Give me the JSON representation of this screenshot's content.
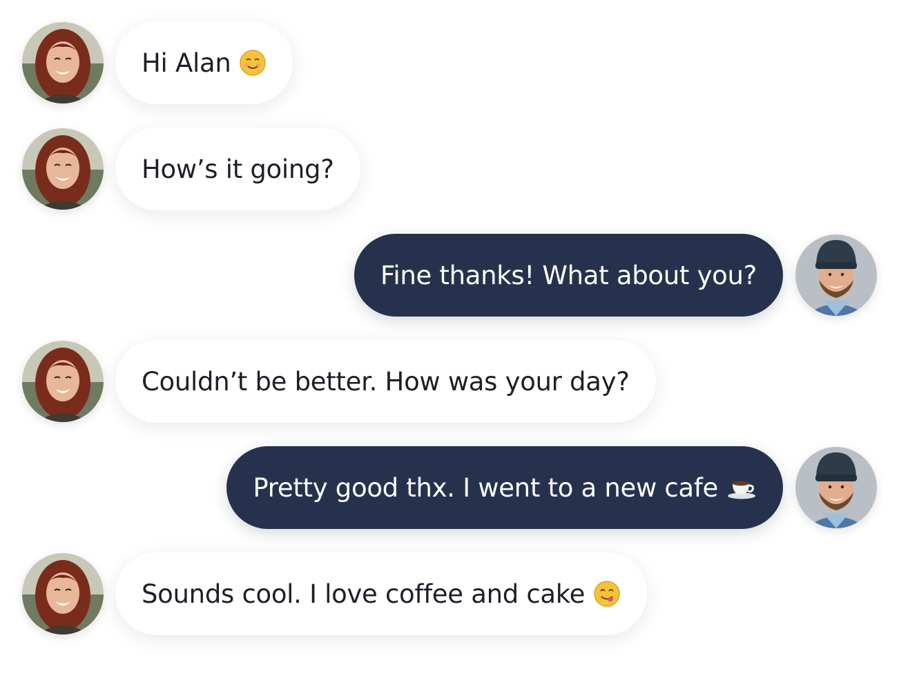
{
  "conversation": {
    "messages": [
      {
        "side": "incoming",
        "text": "Hi Alan",
        "emoji": "smiling-face-icon"
      },
      {
        "side": "incoming",
        "text": "How’s it going?",
        "emoji": ""
      },
      {
        "side": "outgoing",
        "text": "Fine thanks! What about you?",
        "emoji": ""
      },
      {
        "side": "incoming",
        "text": "Couldn’t be better. How was your day?",
        "emoji": ""
      },
      {
        "side": "outgoing",
        "text": "Pretty good thx. I went to a new cafe",
        "emoji": "coffee-icon"
      },
      {
        "side": "incoming",
        "text": "Sounds cool. I love coffee and cake",
        "emoji": "yum-face-icon"
      }
    ]
  },
  "colors": {
    "outgoing_bubble": "#26324d",
    "incoming_bubble": "#ffffff",
    "incoming_text": "#1c1f26",
    "outgoing_text": "#ffffff",
    "emoji_yellow": "#f7c13c"
  },
  "avatars": {
    "incoming": "woman-avatar",
    "outgoing": "man-avatar"
  }
}
